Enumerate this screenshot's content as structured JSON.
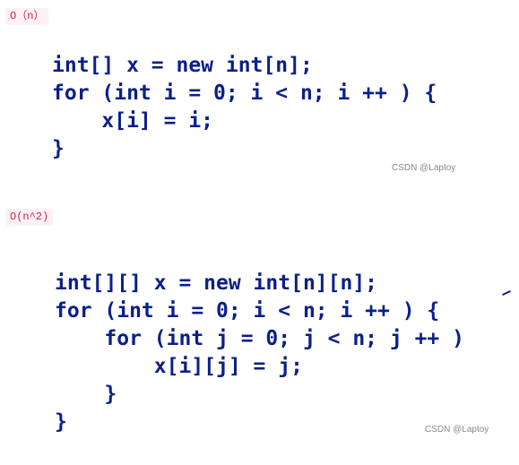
{
  "sections": [
    {
      "label": "O（n）",
      "code_lines": [
        "int[] x = new int[n];",
        "for (int i = 0; i < n; i ++ ) {",
        "    x[i] = i;",
        "}"
      ],
      "watermark": "CSDN @Laptoy"
    },
    {
      "label": "O(n^2)",
      "code_lines": [
        "int[][] x = new int[n][n];",
        "for (int i = 0; i < n; i ++ ) {",
        "    for (int j = 0; j < n; j ++ )",
        "        x[i][j] = j;",
        "    }",
        "}"
      ],
      "watermark": "CSDN @Laptoy"
    }
  ]
}
